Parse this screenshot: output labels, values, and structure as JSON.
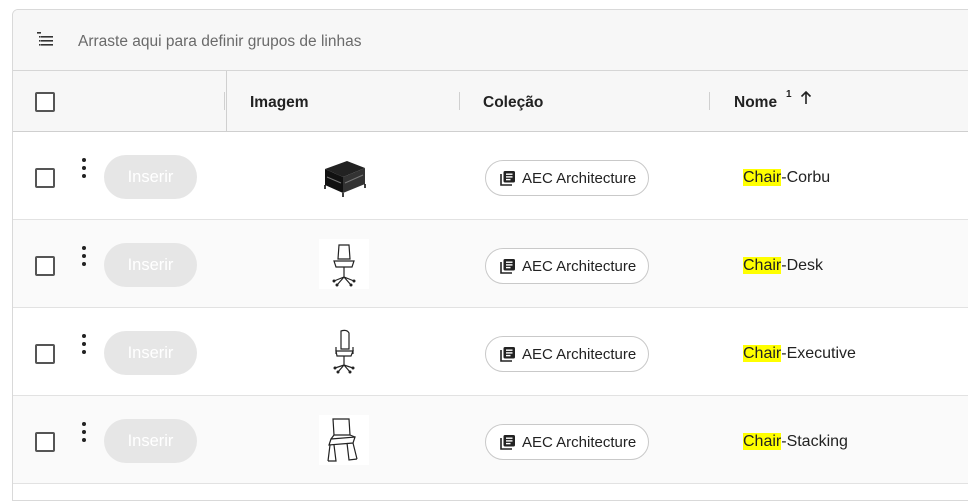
{
  "group_bar": {
    "icon": "group-rows-icon",
    "placeholder": "Arraste aqui para definir grupos de linhas"
  },
  "columns": {
    "image": "Imagem",
    "collection": "Coleção",
    "name": "Nome",
    "name_sort_index": "1",
    "name_sort_direction": "ascending"
  },
  "rows": [
    {
      "insert_label": "Inserir",
      "image_icon": "sofa-armchair-icon",
      "collection": "AEC Architecture",
      "name_highlight": "Chair",
      "name_rest": "-Corbu"
    },
    {
      "insert_label": "Inserir",
      "image_icon": "desk-chair-icon",
      "collection": "AEC Architecture",
      "name_highlight": "Chair",
      "name_rest": "-Desk"
    },
    {
      "insert_label": "Inserir",
      "image_icon": "executive-chair-icon",
      "collection": "AEC Architecture",
      "name_highlight": "Chair",
      "name_rest": "-Executive"
    },
    {
      "insert_label": "Inserir",
      "image_icon": "stacking-chair-icon",
      "collection": "AEC Architecture",
      "name_highlight": "Chair",
      "name_rest": "-Stacking"
    }
  ],
  "colors": {
    "highlight": "#ffff00",
    "insert_button_bg": "#e6e6e6",
    "header_bg": "#f7f7f7"
  }
}
